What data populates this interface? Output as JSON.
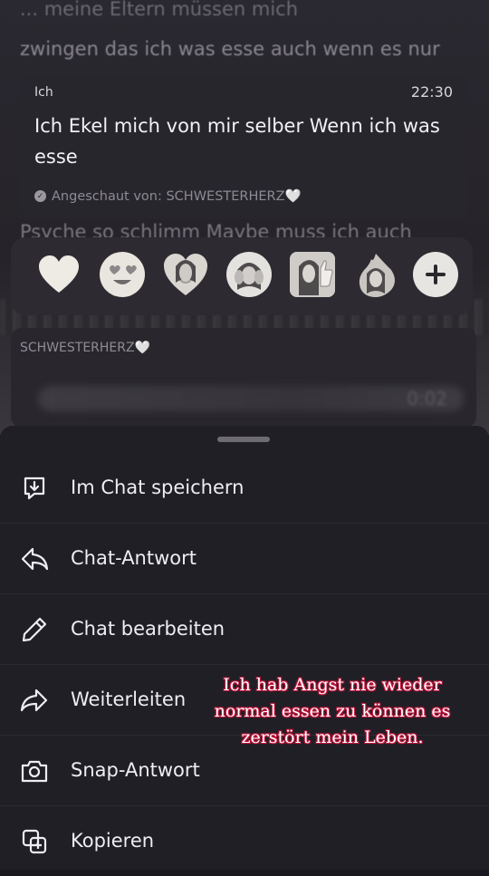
{
  "background": {
    "line_top": "... meine Eltern müssen mich",
    "line_2": "zwingen das ich was esse auch wenn es nur",
    "line_3": "Psyche so schlimm Maybe muss ich auch"
  },
  "message": {
    "sender": "Ich",
    "time": "22:30",
    "text": "Ich Ekel mich von mir selber Wenn ich was esse",
    "seen": "Angeschaut von: SCHWESTERHERZ🤍"
  },
  "reactions": [
    {
      "icon": "white-heart-icon"
    },
    {
      "icon": "heart-eyes-emoji-icon"
    },
    {
      "icon": "bitmoji-heart-icon"
    },
    {
      "icon": "bitmoji-hands-icon"
    },
    {
      "icon": "bitmoji-thumbs-up-icon"
    },
    {
      "icon": "bitmoji-fire-icon"
    },
    {
      "icon": "add-reaction-icon"
    }
  ],
  "second_chat": {
    "sender": "SCHWESTERHERZ🤍",
    "time": "0:02"
  },
  "menu": [
    {
      "label": "Im Chat speichern",
      "icon": "save-in-chat-icon"
    },
    {
      "label": "Chat-Antwort",
      "icon": "reply-icon"
    },
    {
      "label": "Chat bearbeiten",
      "icon": "pencil-icon"
    },
    {
      "label": "Weiterleiten",
      "icon": "forward-icon"
    },
    {
      "label": "Snap-Antwort",
      "icon": "camera-icon"
    },
    {
      "label": "Kopieren",
      "icon": "copy-icon"
    }
  ],
  "overlay_caption": "Ich hab Angst nie wieder normal essen zu können es zerstört mein Leben.",
  "colors": {
    "sheet": "#211f26",
    "card": "#28262d",
    "caption_outline": "#c0163c"
  }
}
